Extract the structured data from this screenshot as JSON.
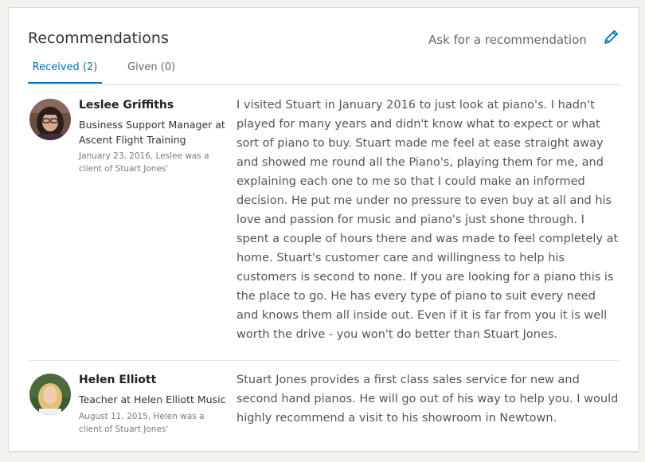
{
  "section": {
    "title": "Recommendations",
    "ask_link": "Ask for a recommendation",
    "edit_icon": "pencil-icon",
    "accent_color": "#0073b1"
  },
  "tabs": [
    {
      "label": "Received (2)",
      "selected": true
    },
    {
      "label": "Given (0)",
      "selected": false
    }
  ],
  "recommendations": [
    {
      "name": "Leslee Griffiths",
      "headline": "Business Support Manager at Ascent Flight Training",
      "meta": "January 23, 2016, Leslee was a client of Stuart Jones'",
      "text": "I visited Stuart in January 2016 to just look at piano's. I hadn't played for many years and didn't know what to expect or what sort of piano to buy. Stuart made me feel at ease straight away and showed me round all the Piano's, playing them for me, and explaining each one to me so that I could make an informed decision. He put me under no pressure to even buy at all and his love and passion for music and piano's just shone through. I spent a couple of hours there and was made to feel completely at home. Stuart's customer care and willingness to help his customers is second to none. If you are looking for a piano this is the place to go. He has every type of piano to suit every need and knows them all inside out. Even if it is far from you it is well worth the drive - you won't do better than Stuart Jones."
    },
    {
      "name": "Helen Elliott",
      "headline": "Teacher at Helen Elliott Music",
      "meta": "August 11, 2015, Helen was a client of Stuart Jones'",
      "text": "Stuart Jones provides a first class sales service for new and second hand pianos. He will go out of his way to help you. I would highly recommend a visit to his showroom in Newtown."
    }
  ]
}
